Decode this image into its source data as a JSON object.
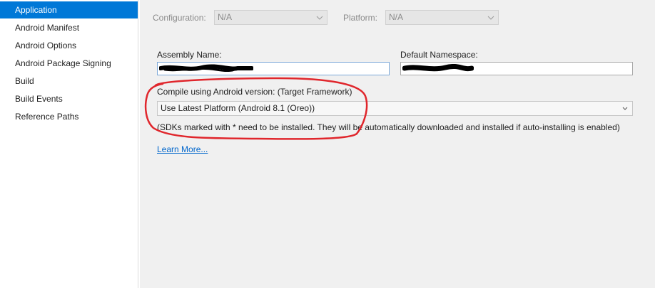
{
  "sidebar": {
    "items": [
      {
        "label": "Application",
        "selected": true
      },
      {
        "label": "Android Manifest"
      },
      {
        "label": "Android Options"
      },
      {
        "label": "Android Package Signing"
      },
      {
        "label": "Build"
      },
      {
        "label": "Build Events"
      },
      {
        "label": "Reference Paths"
      }
    ]
  },
  "toolbar": {
    "configuration_label": "Configuration:",
    "configuration_value": "N/A",
    "platform_label": "Platform:",
    "platform_value": "N/A"
  },
  "form": {
    "assembly_name_label": "Assembly Name:",
    "default_namespace_label": "Default Namespace:",
    "compile_label": "Compile using Android version:  (Target Framework)",
    "target_framework_value": "Use Latest Platform (Android 8.1 (Oreo))",
    "sdk_note": "(SDKs marked with * need to be installed. They will be automatically downloaded and installed if auto-installing is enabled)",
    "learn_more": "Learn More..."
  },
  "colors": {
    "selection": "#0078d7",
    "link": "#0066cc",
    "annotation": "#e0262c"
  },
  "icons": {
    "dropdown": "chevron-down-icon"
  }
}
